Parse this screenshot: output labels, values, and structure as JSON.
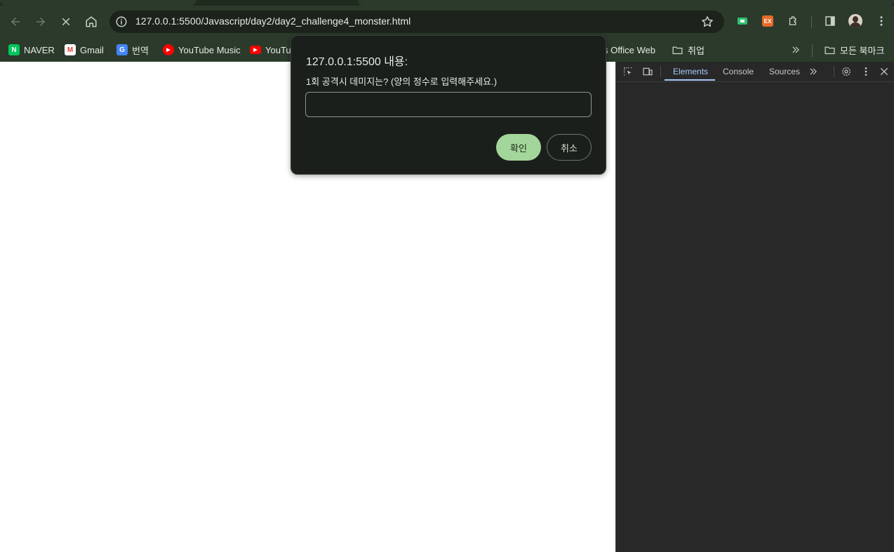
{
  "browser": {
    "url": "127.0.0.1:5500/Javascript/day2/day2_challenge4_monster.html",
    "loading": true
  },
  "bookmarks": {
    "items": [
      {
        "label": "NAVER",
        "icon": "naver-icon",
        "icon_text": "N",
        "color": "#03c75a"
      },
      {
        "label": "Gmail",
        "icon": "gmail-icon",
        "icon_text": "M",
        "color": "#ea4335"
      },
      {
        "label": "번역",
        "icon": "translate-icon",
        "icon_text": "G",
        "color": "#4285f4"
      },
      {
        "label": "YouTube Music",
        "icon": "youtube-music-icon",
        "icon_text": "▶",
        "color": "#ff0000"
      },
      {
        "label": "YouTub",
        "icon": "youtube-icon",
        "icon_text": "▶",
        "color": "#ff0000"
      },
      {
        "label": "s Office Web",
        "icon": "",
        "icon_text": "",
        "color": ""
      },
      {
        "label": "취업",
        "icon": "folder-icon",
        "icon_text": "",
        "color": ""
      }
    ],
    "all_bookmarks_label": "모든 북마크"
  },
  "devtools": {
    "tabs": [
      {
        "label": "Elements",
        "active": true
      },
      {
        "label": "Console",
        "active": false
      },
      {
        "label": "Sources",
        "active": false
      }
    ],
    "accent_color": "#a8c7fa"
  },
  "dialog": {
    "title": "127.0.0.1:5500 내용:",
    "message": "1회 공격시 데미지는? (양의 정수로 입력해주세요.)",
    "input_value": "",
    "ok_label": "확인",
    "cancel_label": "취소",
    "ok_color": "#a3d69a"
  }
}
